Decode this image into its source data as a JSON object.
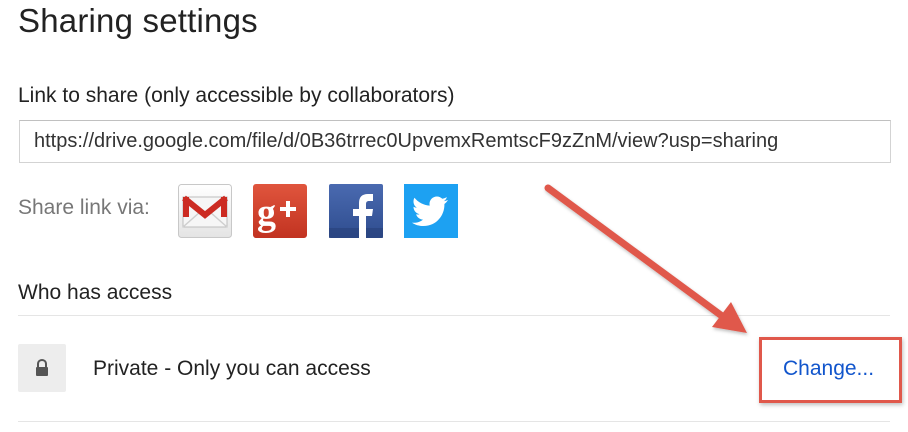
{
  "page": {
    "title": "Sharing settings"
  },
  "link_section": {
    "label": "Link to share (only accessible by collaborators)",
    "url_value": "https://drive.google.com/file/d/0B36trrec0UpvemxRemtscF9zZnM/view?usp=sharing"
  },
  "share_via": {
    "label": "Share link via:",
    "icons": [
      "gmail-icon",
      "google-plus-icon",
      "facebook-icon",
      "twitter-icon"
    ]
  },
  "access": {
    "heading": "Who has access",
    "status_text": "Private - Only you can access",
    "change_label": "Change...",
    "icon": "lock-icon"
  },
  "colors": {
    "link_blue": "#1155cc",
    "annotation_red": "#e0584b",
    "gplus_red": "#d6442e",
    "facebook_blue": "#3b5998",
    "twitter_blue": "#1da1f2"
  }
}
